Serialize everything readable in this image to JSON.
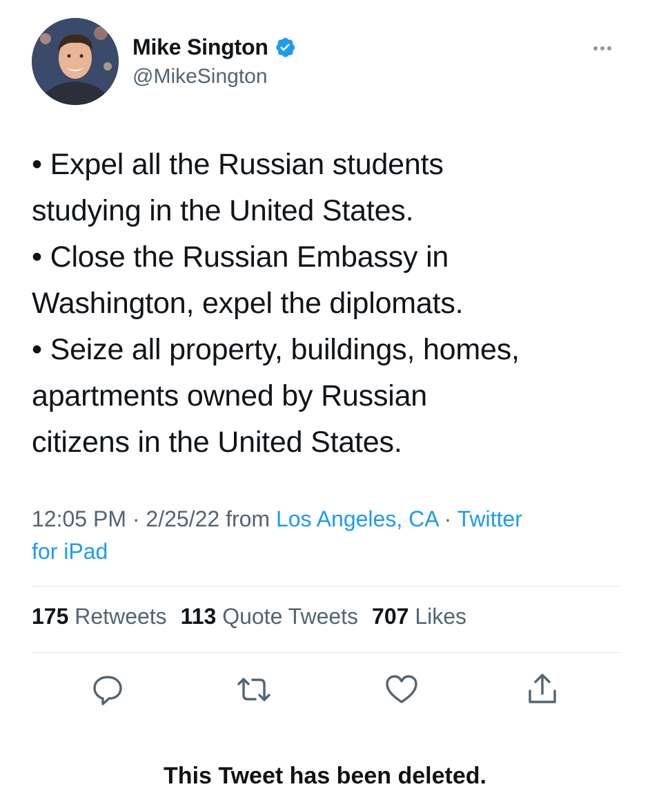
{
  "author": {
    "display_name": "Mike Sington",
    "handle": "@MikeSington",
    "verified": true,
    "avatar_icon": "profile-photo"
  },
  "more_icon": "ellipsis-icon",
  "tweet": {
    "lines": [
      "• Expel all the Russian students",
      "studying in the United States.",
      "• Close the Russian Embassy in",
      "Washington, expel the diplomats.",
      "• Seize all property, buildings, homes,",
      "apartments owned by Russian",
      "citizens in the United States."
    ]
  },
  "meta": {
    "time": "12:05 PM",
    "separator": " · ",
    "date": "2/25/22",
    "from_label": " from ",
    "location": "Los Angeles, CA",
    "source_line1": "Twitter",
    "source_line2": "for iPad"
  },
  "stats": {
    "retweets_count": "175",
    "retweets_label": "Retweets",
    "quotes_count": "113",
    "quotes_label": "Quote Tweets",
    "likes_count": "707",
    "likes_label": "Likes"
  },
  "actions": [
    "reply-icon",
    "retweet-icon",
    "like-icon",
    "share-icon"
  ],
  "footer": {
    "deleted_notice": "This Tweet has been deleted."
  },
  "colors": {
    "link": "#1d9bf0",
    "secondary_text": "#536471",
    "verified_badge": "#1d9bf0"
  }
}
